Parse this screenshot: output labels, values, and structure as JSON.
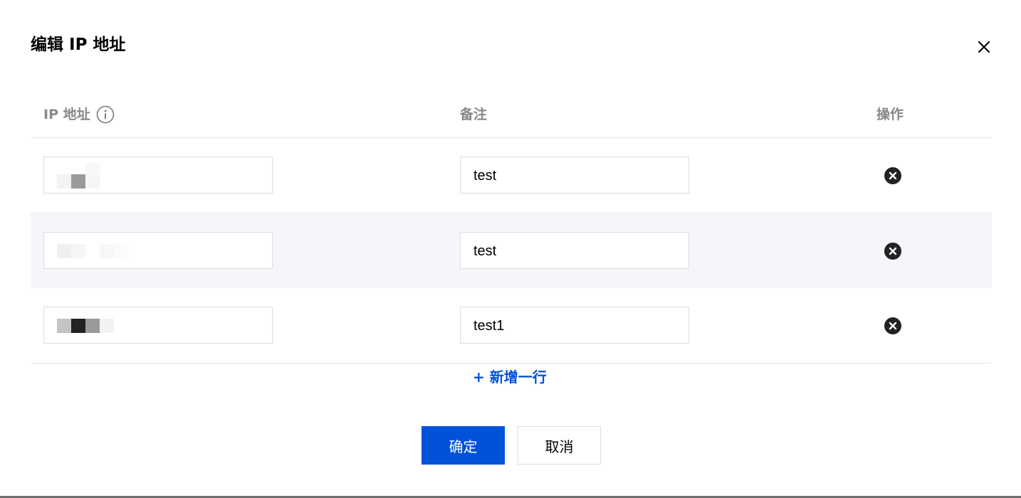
{
  "dialog": {
    "title": "编辑 IP 地址",
    "close_icon": "close-icon"
  },
  "table": {
    "columns": {
      "ip": "IP 地址",
      "note": "备注",
      "op": "操作"
    },
    "info_icon": "info-icon",
    "rows": [
      {
        "ip_masked": true,
        "note": "test",
        "delete_icon": "close-circle-icon"
      },
      {
        "ip_masked": true,
        "note": "test",
        "delete_icon": "close-circle-icon"
      },
      {
        "ip_masked": true,
        "note": "test1",
        "delete_icon": "close-circle-icon"
      }
    ]
  },
  "add_row_label": "+ 新增一行",
  "footer": {
    "confirm_label": "确定",
    "cancel_label": "取消"
  },
  "colors": {
    "primary": "#0052d9",
    "alt_row_bg": "#f5f6fa",
    "border": "#dcdcdc",
    "header_text": "#888888"
  }
}
